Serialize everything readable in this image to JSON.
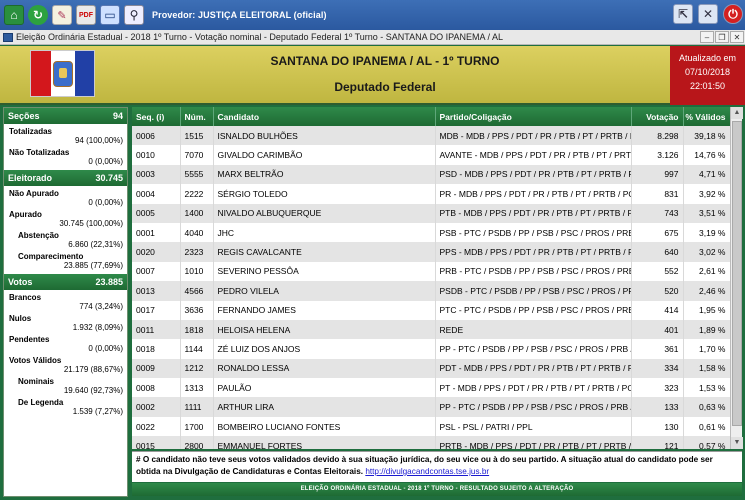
{
  "toolbar": {
    "provider": "Provedor: JUSTIÇA ELEITORAL (oficial)",
    "icons": [
      "home-icon",
      "refresh-icon",
      "edit-icon",
      "pdf-icon",
      "monitor-icon",
      "search-icon",
      "minimize-icon",
      "settings-icon",
      "close-icon"
    ]
  },
  "window": {
    "title": "Eleição Ordinária Estadual - 2018 1º Turno - Votação nominal - Deputado Federal 1º Turno - SANTANA DO IPANEMA / AL"
  },
  "header": {
    "title": "SANTANA DO IPANEMA / AL - 1º TURNO",
    "subtitle": "Deputado Federal",
    "updated_label": "Atualizado em",
    "updated_date": "07/10/2018",
    "updated_time": "22:01:50"
  },
  "sections": {
    "secoes": {
      "label": "Seções",
      "value": "94",
      "totalizadas_label": "Totalizadas",
      "totalizadas_value": "94 (100,00%)",
      "nao_totalizadas_label": "Não Totalizadas",
      "nao_totalizadas_value": "0 (0,00%)"
    },
    "eleitorado": {
      "label": "Eleitorado",
      "value": "30.745",
      "nao_apurado_label": "Não Apurado",
      "nao_apurado_value": "0 (0,00%)",
      "apurado_label": "Apurado",
      "apurado_value": "30.745 (100,00%)",
      "abstencao_label": "Abstenção",
      "abstencao_value": "6.860 (22,31%)",
      "comparecimento_label": "Comparecimento",
      "comparecimento_value": "23.885 (77,69%)"
    },
    "votos": {
      "label": "Votos",
      "value": "23.885",
      "brancos_label": "Brancos",
      "brancos_value": "774 (3,24%)",
      "nulos_label": "Nulos",
      "nulos_value": "1.932 (8,09%)",
      "pendentes_label": "Pendentes",
      "pendentes_value": "0 (0,00%)",
      "validos_label": "Votos Válidos",
      "validos_value": "21.179 (88,67%)",
      "nominais_label": "Nominais",
      "nominais_value": "19.640 (92,73%)",
      "legenda_label": "De Legenda",
      "legenda_value": "1.539 (7,27%)"
    }
  },
  "table": {
    "headers": {
      "seq": "Seq.  (i)",
      "num": "Núm.",
      "candidato": "Candidato",
      "partido": "Partido/Coligação",
      "votacao": "Votação",
      "validos": "% Válidos"
    },
    "rows": [
      {
        "seq": "0006",
        "num": "1515",
        "candidato": "ISNALDO BULHÕES",
        "partido": "MDB - MDB / PPS / PDT / PR / PTB / PT / PRTB / POD...",
        "votacao": "8.298",
        "validos": "39,18 %"
      },
      {
        "seq": "0010",
        "num": "7070",
        "candidato": "GIVALDO CARIMBÃO",
        "partido": "AVANTE - MDB / PPS / PDT / PR / PTB / PT / PRTB / P...",
        "votacao": "3.126",
        "validos": "14,76 %"
      },
      {
        "seq": "0003",
        "num": "5555",
        "candidato": "MARX BELTRÃO",
        "partido": "PSD - MDB / PPS / PDT / PR / PTB / PT / PRTB / POD...",
        "votacao": "997",
        "validos": "4,71 %"
      },
      {
        "seq": "0004",
        "num": "2222",
        "candidato": "SÉRGIO TOLEDO",
        "partido": "PR - MDB / PPS / PDT / PR / PTB / PT / PRTB / PODE ...",
        "votacao": "831",
        "validos": "3,92 %"
      },
      {
        "seq": "0005",
        "num": "1400",
        "candidato": "NIVALDO ALBUQUERQUE",
        "partido": "PTB - MDB / PPS / PDT / PR / PTB / PT / PRTB / POD...",
        "votacao": "743",
        "validos": "3,51 %"
      },
      {
        "seq": "0001",
        "num": "4040",
        "candidato": "JHC",
        "partido": "PSB - PTC / PSDB / PP / PSB / PSC / PROS / PRB / DEM",
        "votacao": "675",
        "validos": "3,19 %"
      },
      {
        "seq": "0020",
        "num": "2323",
        "candidato": "REGIS CAVALCANTE",
        "partido": "PPS - MDB / PPS / PDT / PR / PTB / PT / PRTB / POD...",
        "votacao": "640",
        "validos": "3,02 %"
      },
      {
        "seq": "0007",
        "num": "1010",
        "candidato": "SEVERINO PESSÔA",
        "partido": "PRB - PTC / PSDB / PP / PSB / PSC / PROS / PRB / DEM",
        "votacao": "552",
        "validos": "2,61 %"
      },
      {
        "seq": "0013",
        "num": "4566",
        "candidato": "PEDRO VILELA",
        "partido": "PSDB - PTC / PSDB / PP / PSB / PSC / PROS / PRB / ...",
        "votacao": "520",
        "validos": "2,46 %"
      },
      {
        "seq": "0017",
        "num": "3636",
        "candidato": "FERNANDO JAMES",
        "partido": "PTC - PTC / PSDB / PP / PSB / PSC / PROS / PRB / DEM",
        "votacao": "414",
        "validos": "1,95 %"
      },
      {
        "seq": "0011",
        "num": "1818",
        "candidato": "HELOISA HELENA",
        "partido": "REDE",
        "votacao": "401",
        "validos": "1,89 %"
      },
      {
        "seq": "0018",
        "num": "1144",
        "candidato": "ZÉ LUIZ DOS ANJOS",
        "partido": "PP - PTC / PSDB / PP / PSB / PSC / PROS / PRB / DEM",
        "votacao": "361",
        "validos": "1,70 %"
      },
      {
        "seq": "0009",
        "num": "1212",
        "candidato": "RONALDO LESSA",
        "partido": "PDT - MDB / PPS / PDT / PR / PTB / PT / PRTB / POD...",
        "votacao": "334",
        "validos": "1,58 %"
      },
      {
        "seq": "0008",
        "num": "1313",
        "candidato": "PAULÃO",
        "partido": "PT - MDB / PPS / PDT / PR / PTB / PT / PRTB / PODE ...",
        "votacao": "323",
        "validos": "1,53 %"
      },
      {
        "seq": "0002",
        "num": "1111",
        "candidato": "ARTHUR LIRA",
        "partido": "PP - PTC / PSDB / PP / PSB / PSC / PROS / PRB / DEM",
        "votacao": "133",
        "validos": "0,63 %"
      },
      {
        "seq": "0022",
        "num": "1700",
        "candidato": "BOMBEIRO LUCIANO FONTES",
        "partido": "PSL - PSL / PATRI / PPL",
        "votacao": "130",
        "validos": "0,61 %"
      },
      {
        "seq": "0015",
        "num": "2800",
        "candidato": "EMMANUEL FORTES",
        "partido": "PRTB - MDB / PPS / PDT / PR / PTB / PT / PRTB / PO...",
        "votacao": "121",
        "validos": "0,57 %"
      }
    ]
  },
  "note": {
    "text": "# O candidato não teve seus votos validados devido à sua situação jurídica, do seu vice ou à do seu partido. A situação atual do candidato pode ser obtida na Divulgação de Candidaturas e Contas Eleitorais.",
    "link": "http://divulgacandcontas.tse.jus.br"
  },
  "footer": {
    "text": "ELEIÇÃO ORDINÁRIA ESTADUAL - 2018 1º TURNO - RESULTADO SUJEITO A ALTERAÇÃO"
  }
}
